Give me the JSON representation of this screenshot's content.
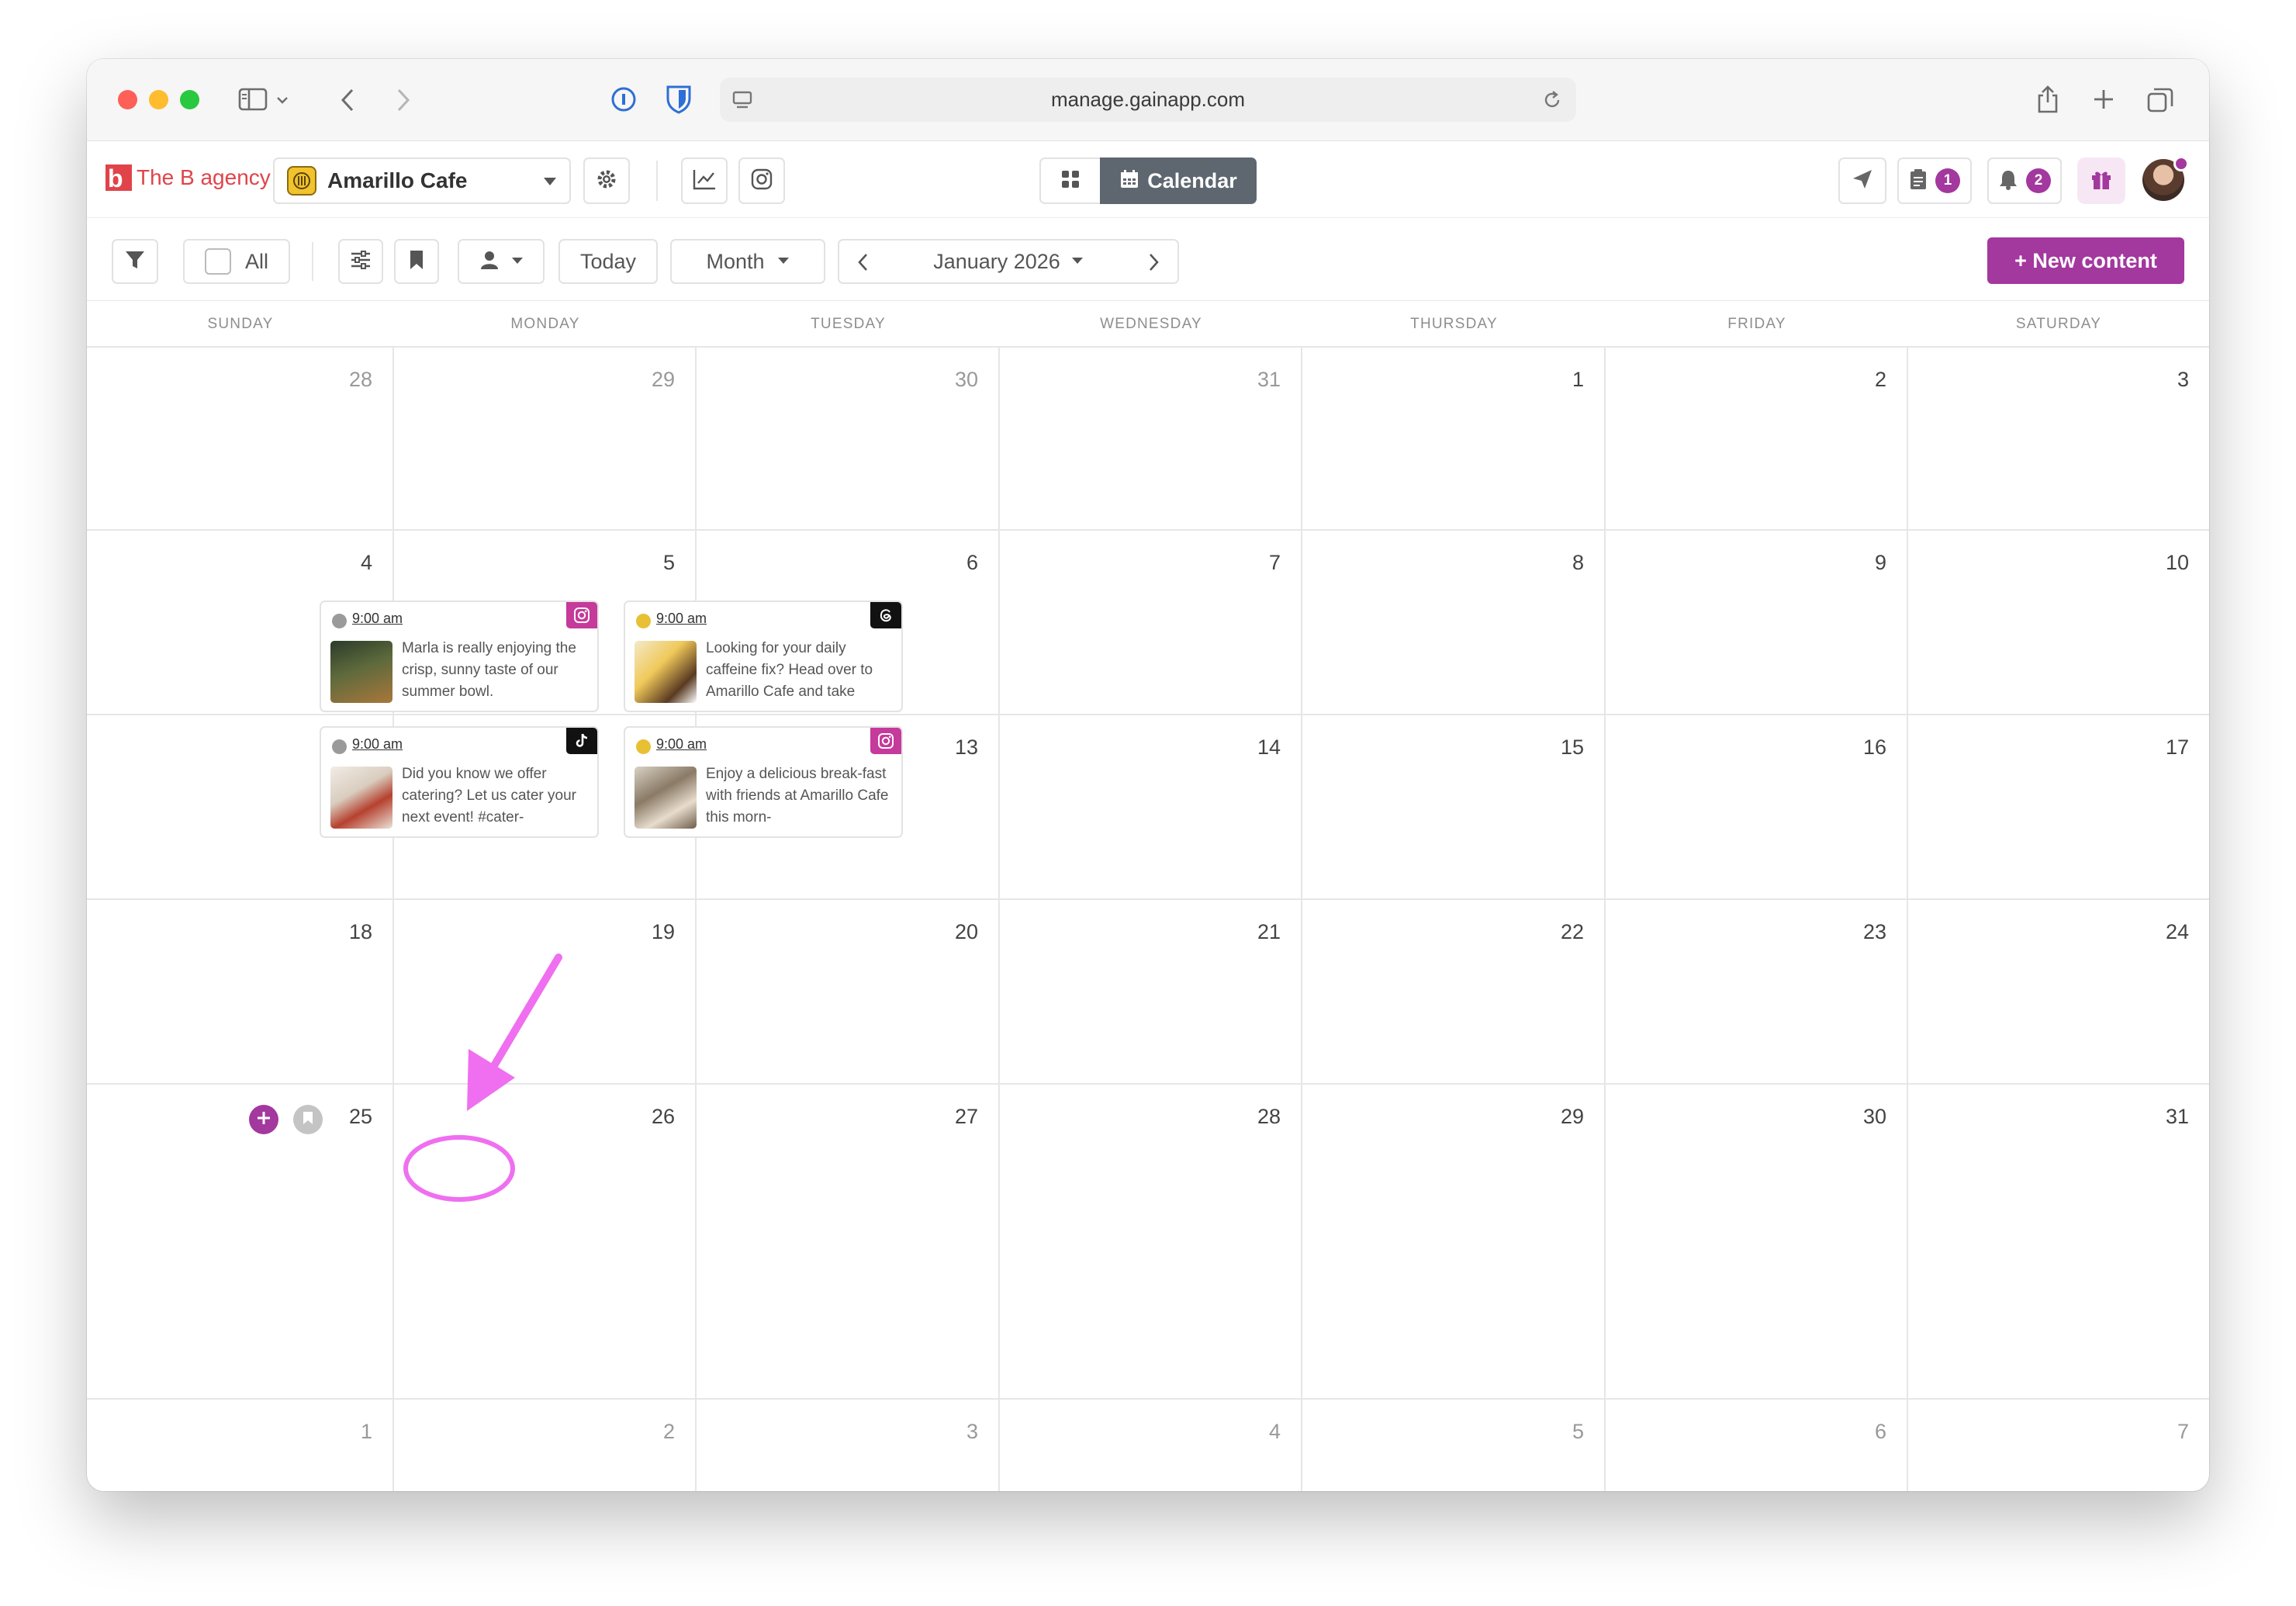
{
  "browser": {
    "url": "manage.gainapp.com"
  },
  "header": {
    "agency_logo_letter": "b",
    "agency_name": "The B agency",
    "brand_name": "Amarillo Cafe",
    "view_calendar_label": "Calendar",
    "drafts_count": "1",
    "notifications_count": "2",
    "colors": {
      "accent": "#a3389e",
      "agency_red": "#e0444a",
      "active_tab": "#5e6670"
    }
  },
  "toolbar": {
    "all_label": "All",
    "today_label": "Today",
    "view_mode": "Month",
    "period_label": "January 2026",
    "new_content_label": "+ New content"
  },
  "calendar": {
    "weekdays": [
      "SUNDAY",
      "MONDAY",
      "TUESDAY",
      "WEDNESDAY",
      "THURSDAY",
      "FRIDAY",
      "SATURDAY"
    ],
    "weeks": [
      [
        {
          "d": "28",
          "other": true
        },
        {
          "d": "29",
          "other": true
        },
        {
          "d": "30",
          "other": true
        },
        {
          "d": "31",
          "other": true
        },
        {
          "d": "1"
        },
        {
          "d": "2"
        },
        {
          "d": "3"
        }
      ],
      [
        {
          "d": "4"
        },
        {
          "d": "5"
        },
        {
          "d": "6"
        },
        {
          "d": "7"
        },
        {
          "d": "8"
        },
        {
          "d": "9"
        },
        {
          "d": "10"
        }
      ],
      [
        {
          "d": "11"
        },
        {
          "d": "12"
        },
        {
          "d": "13"
        },
        {
          "d": "14"
        },
        {
          "d": "15"
        },
        {
          "d": "16"
        },
        {
          "d": "17"
        }
      ],
      [
        {
          "d": "18"
        },
        {
          "d": "19"
        },
        {
          "d": "20"
        },
        {
          "d": "21"
        },
        {
          "d": "22"
        },
        {
          "d": "23"
        },
        {
          "d": "24"
        }
      ],
      [
        {
          "d": "25"
        },
        {
          "d": "26"
        },
        {
          "d": "27"
        },
        {
          "d": "28"
        },
        {
          "d": "29"
        },
        {
          "d": "30"
        },
        {
          "d": "31"
        }
      ],
      [
        {
          "d": "1",
          "other": true
        },
        {
          "d": "2",
          "other": true
        },
        {
          "d": "3",
          "other": true
        },
        {
          "d": "4",
          "other": true
        },
        {
          "d": "5",
          "other": true
        },
        {
          "d": "6",
          "other": true
        },
        {
          "d": "7",
          "other": true
        }
      ]
    ],
    "posts": [
      {
        "day": "26",
        "time": "9:00 am",
        "status_color": "#9a9a9a",
        "network": "instagram-icon",
        "network_color": "#c53a9a",
        "text": "Marla is really enjoying the crisp, sunny taste of our summer bowl."
      },
      {
        "day": "27",
        "time": "9:00 am",
        "status_color": "#e8c033",
        "network": "threads-icon",
        "network_color": "#111111",
        "text": "Looking for your daily caffeine fix? Head over to Amarillo Cafe and take"
      },
      {
        "day": "26",
        "time": "9:00 am",
        "status_color": "#9a9a9a",
        "network": "tiktok-icon",
        "network_color": "#111111",
        "text": "Did you know we offer catering? Let us cater your next event! #cater-"
      },
      {
        "day": "27",
        "time": "9:00 am",
        "status_color": "#e8c033",
        "network": "instagram-icon",
        "network_color": "#c53a9a",
        "text": "Enjoy a delicious break-fast with friends at Amarillo Cafe this morn-"
      }
    ]
  },
  "annotation": {
    "color": "#ef6ff0"
  }
}
